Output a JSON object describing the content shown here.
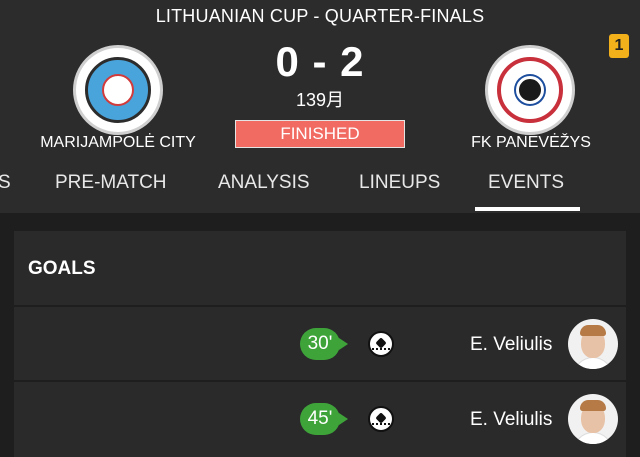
{
  "match": {
    "competition": "LITHUANIAN CUP - QUARTER-FINALS",
    "home_team": "MARIJAMPOLĖ CITY",
    "away_team": "FK PANEVĖŽYS",
    "score": "0 - 2",
    "minute": "139月",
    "status": "FINISHED",
    "notification_count": "1"
  },
  "tabs": [
    {
      "label": "S",
      "active": false
    },
    {
      "label": "PRE-MATCH",
      "active": false
    },
    {
      "label": "ANALYSIS",
      "active": false
    },
    {
      "label": "LINEUPS",
      "active": false
    },
    {
      "label": "EVENTS",
      "active": true
    }
  ],
  "goals": {
    "title": "GOALS",
    "events": [
      {
        "minute": "30'",
        "icon": "soccer-ball-icon",
        "player": "E. Veliulis"
      },
      {
        "minute": "45'",
        "icon": "soccer-ball-icon",
        "player": "E. Veliulis"
      }
    ]
  },
  "colors": {
    "header_bg": "#2c2c2c",
    "page_bg": "#1e1e1e",
    "card_bg": "#2a2a2a",
    "status_bg": "#f26b63",
    "goal_green": "#3ea43a",
    "badge_yellow": "#f2b01b"
  }
}
